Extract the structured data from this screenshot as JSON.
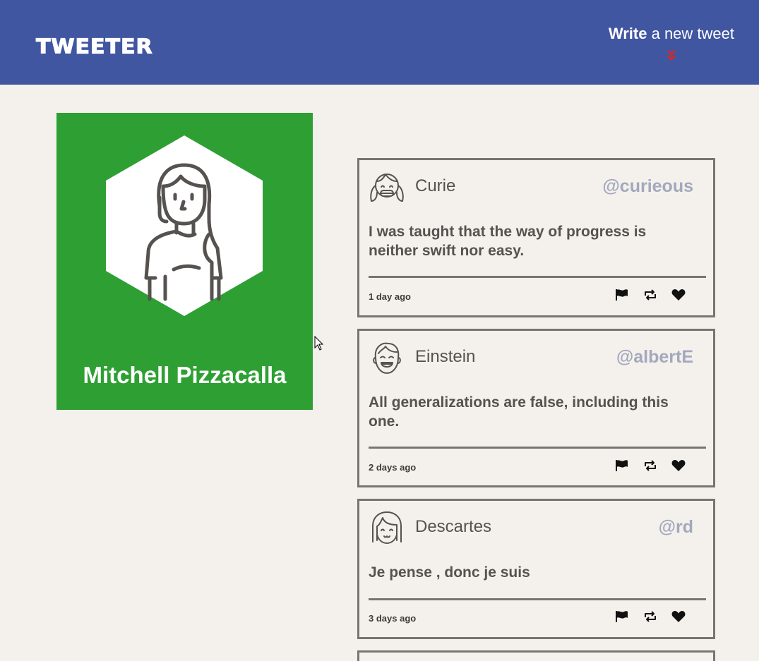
{
  "header": {
    "logo": "TWEETER",
    "compose_strong": "Write",
    "compose_rest": " a new tweet",
    "chevron_icon": "double-chevron-down-icon",
    "chevron_color": "#d62828",
    "background": "#4056a1"
  },
  "profile": {
    "name": "Mitchell Pizzacalla",
    "background": "#2ea033",
    "avatar_icon": "woman-avatar-icon"
  },
  "tweets": [
    {
      "name": "Curie",
      "handle": "@curieous",
      "text": "I was taught that the way of progress is neither swift nor easy.",
      "time": "1 day ago",
      "avatar_icon": "girl-pigtails-avatar-icon"
    },
    {
      "name": "Einstein",
      "handle": "@albertE",
      "text": "All generalizations are false, including this one.",
      "time": "2 days ago",
      "avatar_icon": "laughing-boy-avatar-icon"
    },
    {
      "name": "Descartes",
      "handle": "@rd",
      "text": "Je pense , donc je suis",
      "time": "3 days ago",
      "avatar_icon": "bob-hair-avatar-icon"
    }
  ],
  "actions": {
    "flag_icon": "flag-icon",
    "retweet_icon": "retweet-icon",
    "like_icon": "heart-icon"
  },
  "colors": {
    "page_background": "#f4f1ec",
    "tweet_border": "#777472",
    "handle": "#a3a8bd",
    "text": "#555250"
  }
}
